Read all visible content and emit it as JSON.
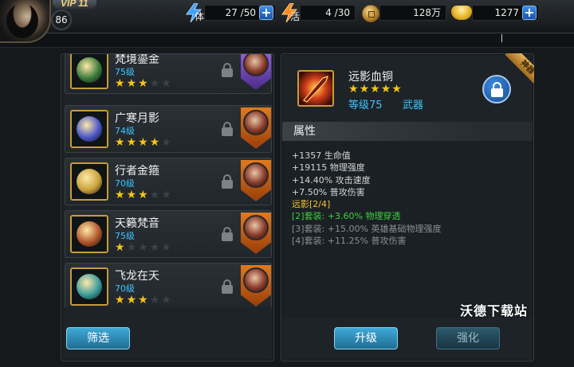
{
  "player": {
    "vip": "VIP 11",
    "level": "86"
  },
  "resources": {
    "stamina": {
      "label": "体",
      "value": "27 /50"
    },
    "energy": {
      "label": "活",
      "value": "4 /30"
    },
    "coins": {
      "value": "128万"
    },
    "gold": {
      "value": "1277"
    },
    "plus": "+"
  },
  "equipment_list": [
    {
      "name": "梵境鎏金",
      "level": "75级",
      "stars": 3,
      "max_stars": 5,
      "gem_color": "#3a7a3a",
      "hero_frame": "purple"
    },
    {
      "name": "广寒月影",
      "level": "74级",
      "stars": 4,
      "max_stars": 5,
      "gem_color": "#4a56c8",
      "hero_frame": "orange"
    },
    {
      "name": "行者金箍",
      "level": "70级",
      "stars": 3,
      "max_stars": 5,
      "gem_color": "#c8a23a",
      "hero_frame": "orange"
    },
    {
      "name": "天籁梵音",
      "level": "75级",
      "stars": 1,
      "max_stars": 5,
      "gem_color": "#b0542a",
      "hero_frame": "orange"
    },
    {
      "name": "飞龙在天",
      "level": "70级",
      "stars": 3,
      "max_stars": 5,
      "gem_color": "#3a9c9c",
      "hero_frame": "orange"
    }
  ],
  "filter_button": "筛选",
  "detail": {
    "name": "远影血铜",
    "stars": 5,
    "level_label": "等级75",
    "type": "武器",
    "ribbon": "神器",
    "section_title": "属性",
    "base_attrs": [
      "+1357 生命值",
      "+19115 物理强度",
      "+14.40% 攻击速度",
      "+7.50% 普攻伤害"
    ],
    "set_title": "远影[2/4]",
    "set_bonuses": [
      {
        "text": "[2]套装: +3.60% 物理穿透",
        "active": true
      },
      {
        "text": "[3]套装: +15.00% 英雄基础物理强度",
        "active": false
      },
      {
        "text": "[4]套装: +11.25% 普攻伤害",
        "active": false
      }
    ],
    "upgrade_button": "升级",
    "enhance_button": "强化"
  },
  "watermark": "沃德下载站",
  "colors": {
    "star_on": "#f5c518",
    "star_off": "#3b4146",
    "level_blue": "#3fc6ff",
    "active_set": "#3ccf3c"
  }
}
